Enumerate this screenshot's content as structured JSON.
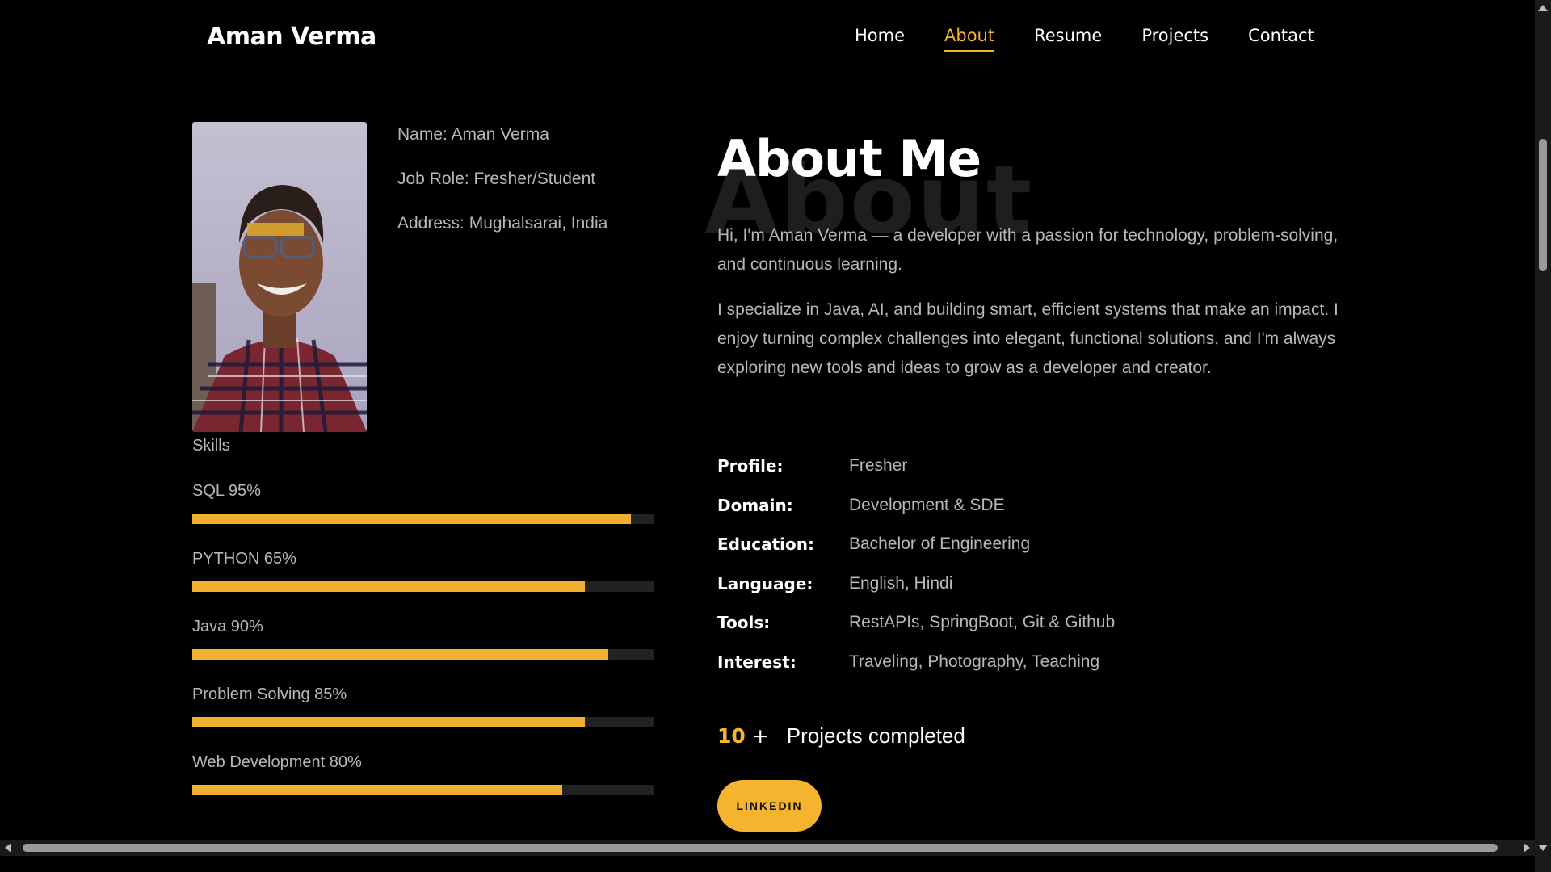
{
  "header": {
    "brand": "Aman Verma",
    "nav": [
      {
        "label": "Home",
        "active": false
      },
      {
        "label": "About",
        "active": true
      },
      {
        "label": "Resume",
        "active": false
      },
      {
        "label": "Projects",
        "active": false
      },
      {
        "label": "Contact",
        "active": false
      }
    ]
  },
  "profile": {
    "name": "Name: Aman Verma",
    "job_role": "Job Role: Fresher/Student",
    "address": "Address: Mughalsarai, India"
  },
  "skills": {
    "heading": "Skills",
    "items": [
      {
        "label": "SQL 95%",
        "percent": 95
      },
      {
        "label": "PYTHON 65%",
        "percent": 85
      },
      {
        "label": "Java 90%",
        "percent": 90
      },
      {
        "label": "Problem Solving 85%",
        "percent": 85
      },
      {
        "label": "Web Development 80%",
        "percent": 80
      }
    ]
  },
  "about": {
    "background_word": "About",
    "title": "About Me",
    "bio": [
      "Hi, I'm Aman Verma — a developer with a passion for technology, problem-solving, and continuous learning.",
      "I specialize in Java, AI, and building smart, efficient systems that make an impact. I enjoy turning complex challenges into elegant, functional solutions, and I'm always exploring new tools and ideas to grow as a developer and creator."
    ],
    "details": [
      {
        "key": "Profile:",
        "value": "Fresher"
      },
      {
        "key": "Domain:",
        "value": "Development & SDE"
      },
      {
        "key": "Education:",
        "value": "Bachelor of Engineering"
      },
      {
        "key": "Language:",
        "value": "English, Hindi"
      },
      {
        "key": "Tools:",
        "value": "RestAPIs, SpringBoot, Git & Github"
      },
      {
        "key": "Interest:",
        "value": "Traveling, Photography, Teaching"
      }
    ],
    "counter": {
      "number": "10",
      "plus": "+",
      "label": "Projects completed"
    },
    "linkedin_label": "LINKEDIN"
  },
  "colors": {
    "accent": "#f5b42d",
    "background": "#000000",
    "muted_text": "#b8b8b8"
  }
}
